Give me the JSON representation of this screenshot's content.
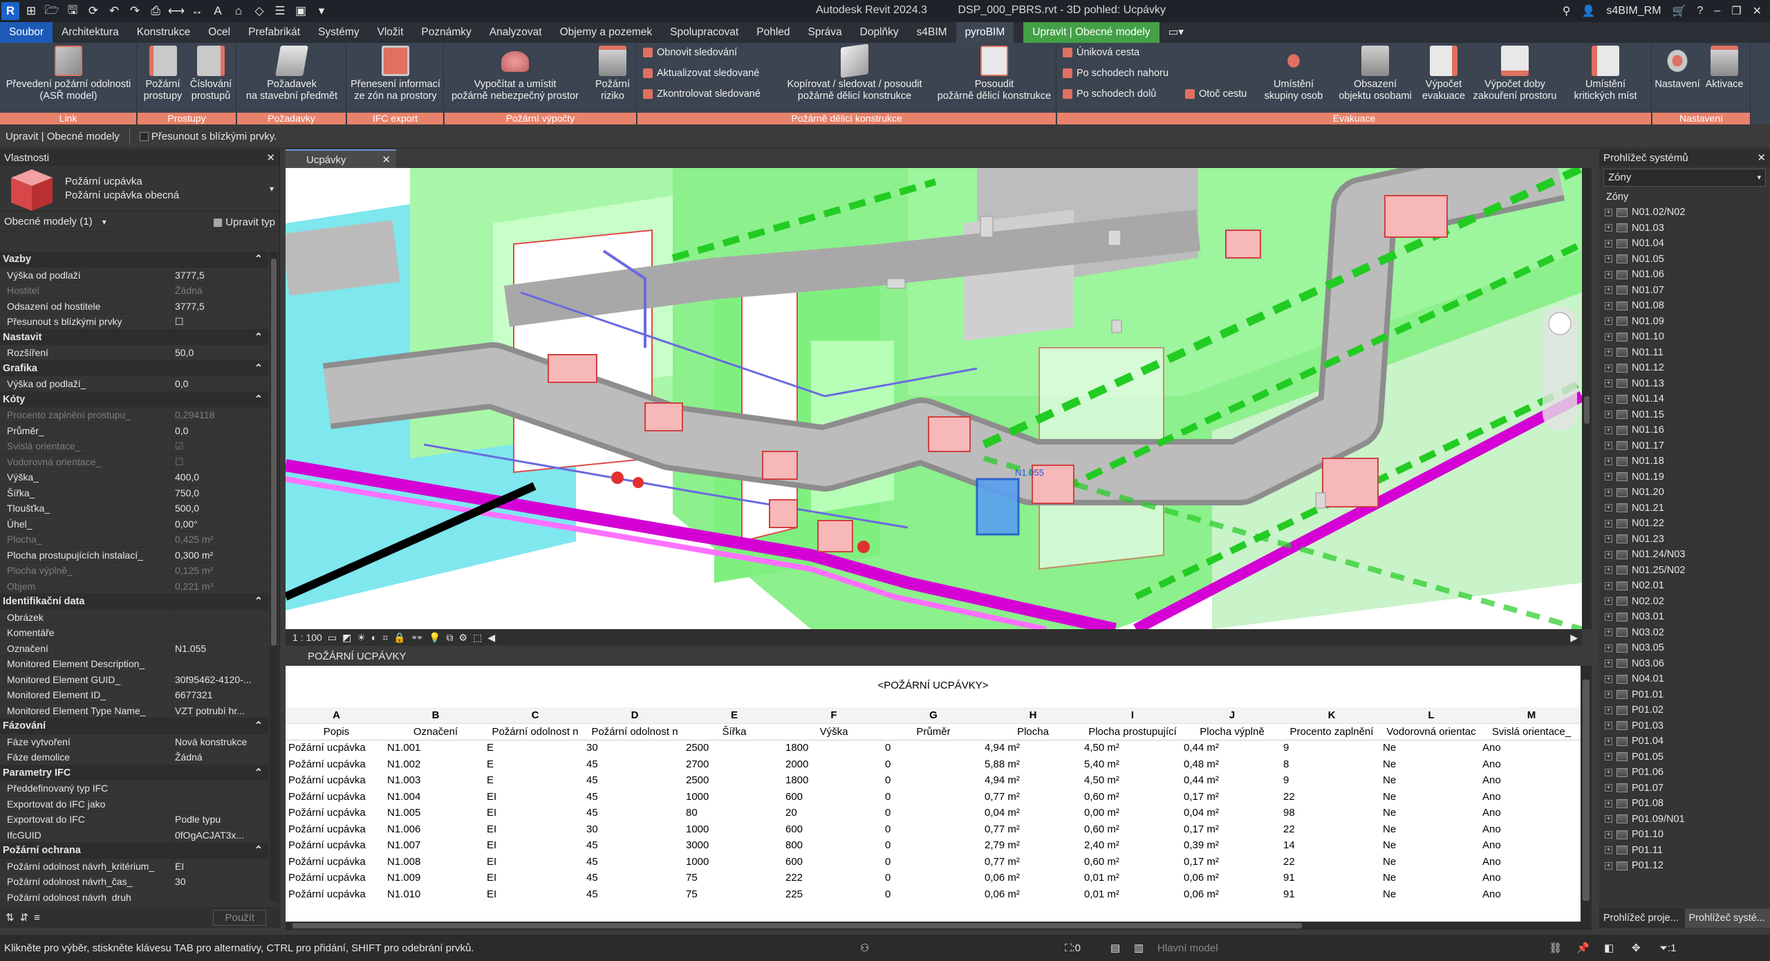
{
  "titlebar": {
    "app": "Autodesk Revit 2024.3",
    "file": "DSP_000_PBRS.rvt - 3D pohled: Ucpávky",
    "user": "s4BIM_RM",
    "logo": "R"
  },
  "menu": {
    "tabs": [
      "Soubor",
      "Architektura",
      "Konstrukce",
      "Ocel",
      "Prefabrikát",
      "Systémy",
      "Vložit",
      "Poznámky",
      "Analyzovat",
      "Objemy a pozemek",
      "Spolupracovat",
      "Pohled",
      "Správa",
      "Doplňky",
      "s4BIM",
      "pyroBIM"
    ],
    "context_tab": "Upravit | Obecné modely"
  },
  "ribbon": {
    "panels": [
      "Link",
      "Prostupy",
      "Požadavky",
      "IFC export",
      "Požární výpočty",
      "Požárně dělicí konstrukce",
      "Evakuace",
      "Nastavení"
    ],
    "link_btn": "Převedení požární odolnosti\n(ASŘ model)",
    "prostupy_btn": "Požární\nprostupy",
    "cislovani_btn": "Číslování\nprostupů",
    "pozadavek_btn": "Požadavek\nna stavební předmět",
    "prenos_btn": "Přenesení informací\nze zón na prostory",
    "vypocet_btn": "Vypočítat a umístit\npožárně nebezpečný prostor",
    "riziko_btn": "Požární\nriziko",
    "obnovit": "Obnovit sledování",
    "aktualizovat": "Aktualizovat sledované",
    "zkontrolovat": "Zkontrolovat sledované",
    "kopirovat_btn": "Kopírovat / sledovat / posoudit\npožárně dělicí konstrukce",
    "posoudit_btn": "Posoudit\npožárně dělicí konstrukce",
    "unikova": "Úniková cesta",
    "nahoru": "Po schodech nahoru",
    "dolu": "Po schodech dolů",
    "otoc": "Otoč cestu",
    "skupiny_btn": "Umístění\nskupiny osob",
    "obsazeni_btn": "Obsazení\nobjektu osobami",
    "evakuace_btn": "Výpočet\nevakuace",
    "doba_btn": "Výpočet doby\nzakouření prostoru",
    "kriticke_btn": "Umístění\nkritických míst",
    "nastaveni_btn": "Nastavení",
    "aktivace_btn": "Aktivace"
  },
  "optbar": {
    "mode": "Upravit | Obecné modely",
    "move_label": "Přesunout s blízkými prvky."
  },
  "properties": {
    "title": "Vlastnosti",
    "type_name": "Požární ucpávka",
    "type_sub": "Požární ucpávka obecná",
    "selector": "Obecné modely (1)",
    "edit_type": "Upravit typ",
    "apply": "Použít",
    "groups": [
      {
        "name": "Vazby",
        "rows": [
          [
            "Výška od podlaží",
            "3777,5",
            false
          ],
          [
            "Hostitel",
            "Žádná",
            true
          ],
          [
            "Odsazení od hostitele",
            "3777,5",
            false
          ],
          [
            "Přesunout s blízkými prvky",
            "☐",
            false
          ]
        ]
      },
      {
        "name": "Nastavit",
        "rows": [
          [
            "Rozšíření",
            "50,0",
            false
          ]
        ]
      },
      {
        "name": "Grafika",
        "rows": [
          [
            "Výška od podlaží_",
            "0,0",
            false
          ]
        ]
      },
      {
        "name": "Kóty",
        "rows": [
          [
            "Procento zaplnění prostupu_",
            "0,294118",
            true
          ],
          [
            "Průměr_",
            "0,0",
            false
          ],
          [
            "Svislá orientace_",
            "☑",
            true
          ],
          [
            "Vodorovná orientace_",
            "☐",
            true
          ],
          [
            "Výška_",
            "400,0",
            false
          ],
          [
            "Šířka_",
            "750,0",
            false
          ],
          [
            "Tloušťka_",
            "500,0",
            false
          ],
          [
            "Úhel_",
            "0,00°",
            false
          ],
          [
            "Plocha_",
            "0,425 m²",
            true
          ],
          [
            "Plocha prostupujících instalací_",
            "0,300 m²",
            false
          ],
          [
            "Plocha výplně_",
            "0,125 m²",
            true
          ],
          [
            "Objem",
            "0,221 m³",
            true
          ]
        ]
      },
      {
        "name": "Identifikační data",
        "rows": [
          [
            "Obrázek",
            "",
            false
          ],
          [
            "Komentáře",
            "",
            false
          ],
          [
            "Označení",
            "N1.055",
            false
          ],
          [
            "Monitored Element Description_",
            "",
            false
          ],
          [
            "Monitored Element GUID_",
            "30f95462-4120-...",
            false
          ],
          [
            "Monitored Element ID_",
            "6677321",
            false
          ],
          [
            "Monitored Element Type Name_",
            "VZT potrubí hr...",
            false
          ]
        ]
      },
      {
        "name": "Fázování",
        "rows": [
          [
            "Fáze vytvoření",
            "Nová konstrukce",
            false
          ],
          [
            "Fáze demolice",
            "Žádná",
            false
          ]
        ]
      },
      {
        "name": "Parametry IFC",
        "rows": [
          [
            "Předdefinovaný typ IFC",
            "",
            false
          ],
          [
            "Exportovat do IFC jako",
            "",
            false
          ],
          [
            "Exportovat do IFC",
            "Podle typu",
            false
          ],
          [
            "IfcGUID",
            "0fOgACJAT3x...",
            false
          ]
        ]
      },
      {
        "name": "Požární ochrana",
        "rows": [
          [
            "Požární odolnost návrh_kritérium_",
            "EI",
            false
          ],
          [
            "Požární odolnost návrh_čas_",
            "30",
            false
          ],
          [
            "Požární odolnost návrh_druh_",
            "",
            false
          ]
        ]
      }
    ]
  },
  "view": {
    "tab": "Ucpávky",
    "scale": "1 : 100",
    "tag_label": "N1.055"
  },
  "schedule": {
    "tab": "POŽÁRNÍ UCPÁVKY",
    "title": "<POŽÁRNÍ UCPÁVKY>",
    "letters": [
      "A",
      "B",
      "C",
      "D",
      "E",
      "F",
      "G",
      "H",
      "I",
      "J",
      "K",
      "L",
      "M"
    ],
    "headers": [
      "Popis",
      "Označení",
      "Požární odolnost n",
      "Požární odolnost n",
      "Šířka",
      "Výška",
      "Průměr",
      "Plocha",
      "Plocha prostupující",
      "Plocha výplně",
      "Procento zaplnění",
      "Vodorovná orientac",
      "Svislá orientace_"
    ],
    "rows": [
      [
        "Požární ucpávka",
        "N1.001",
        "E",
        "30",
        "2500",
        "1800",
        "0",
        "4,94 m²",
        "4,50 m²",
        "0,44 m²",
        "9",
        "Ne",
        "Ano"
      ],
      [
        "Požární ucpávka",
        "N1.002",
        "E",
        "45",
        "2700",
        "2000",
        "0",
        "5,88 m²",
        "5,40 m²",
        "0,48 m²",
        "8",
        "Ne",
        "Ano"
      ],
      [
        "Požární ucpávka",
        "N1.003",
        "E",
        "45",
        "2500",
        "1800",
        "0",
        "4,94 m²",
        "4,50 m²",
        "0,44 m²",
        "9",
        "Ne",
        "Ano"
      ],
      [
        "Požární ucpávka",
        "N1.004",
        "EI",
        "45",
        "1000",
        "600",
        "0",
        "0,77 m²",
        "0,60 m²",
        "0,17 m²",
        "22",
        "Ne",
        "Ano"
      ],
      [
        "Požární ucpávka",
        "N1.005",
        "EI",
        "45",
        "80",
        "20",
        "0",
        "0,04 m²",
        "0,00 m²",
        "0,04 m²",
        "98",
        "Ne",
        "Ano"
      ],
      [
        "Požární ucpávka",
        "N1.006",
        "EI",
        "30",
        "1000",
        "600",
        "0",
        "0,77 m²",
        "0,60 m²",
        "0,17 m²",
        "22",
        "Ne",
        "Ano"
      ],
      [
        "Požární ucpávka",
        "N1.007",
        "EI",
        "45",
        "3000",
        "800",
        "0",
        "2,79 m²",
        "2,40 m²",
        "0,39 m²",
        "14",
        "Ne",
        "Ano"
      ],
      [
        "Požární ucpávka",
        "N1.008",
        "EI",
        "45",
        "1000",
        "600",
        "0",
        "0,77 m²",
        "0,60 m²",
        "0,17 m²",
        "22",
        "Ne",
        "Ano"
      ],
      [
        "Požární ucpávka",
        "N1.009",
        "EI",
        "45",
        "75",
        "222",
        "0",
        "0,06 m²",
        "0,01 m²",
        "0,06 m²",
        "91",
        "Ne",
        "Ano"
      ],
      [
        "Požární ucpávka",
        "N1.010",
        "EI",
        "45",
        "75",
        "225",
        "0",
        "0,06 m²",
        "0,01 m²",
        "0,06 m²",
        "91",
        "Ne",
        "Ano"
      ]
    ]
  },
  "browser": {
    "title": "Prohlížeč systémů",
    "selector": "Zóny",
    "root": "Zóny",
    "items": [
      "N01.02/N02",
      "N01.03",
      "N01.04",
      "N01.05",
      "N01.06",
      "N01.07",
      "N01.08",
      "N01.09",
      "N01.10",
      "N01.11",
      "N01.12",
      "N01.13",
      "N01.14",
      "N01.15",
      "N01.16",
      "N01.17",
      "N01.18",
      "N01.19",
      "N01.20",
      "N01.21",
      "N01.22",
      "N01.23",
      "N01.24/N03",
      "N01.25/N02",
      "N02.01",
      "N02.02",
      "N03.01",
      "N03.02",
      "N03.05",
      "N03.06",
      "N04.01",
      "P01.01",
      "P01.02",
      "P01.03",
      "P01.04",
      "P01.05",
      "P01.06",
      "P01.07",
      "P01.08",
      "P01.09/N01",
      "P01.10",
      "P01.11",
      "P01.12"
    ],
    "tab1": "Prohlížeč proje...",
    "tab2": "Prohlížeč systé..."
  },
  "status": {
    "hint": "Klikněte pro výběr, stiskněte klávesu TAB pro alternativy, CTRL pro přidání, SHIFT pro odebrání prvků.",
    "model": "Hlavní model",
    "sel_count": ":0",
    "filter_count": ":1"
  }
}
